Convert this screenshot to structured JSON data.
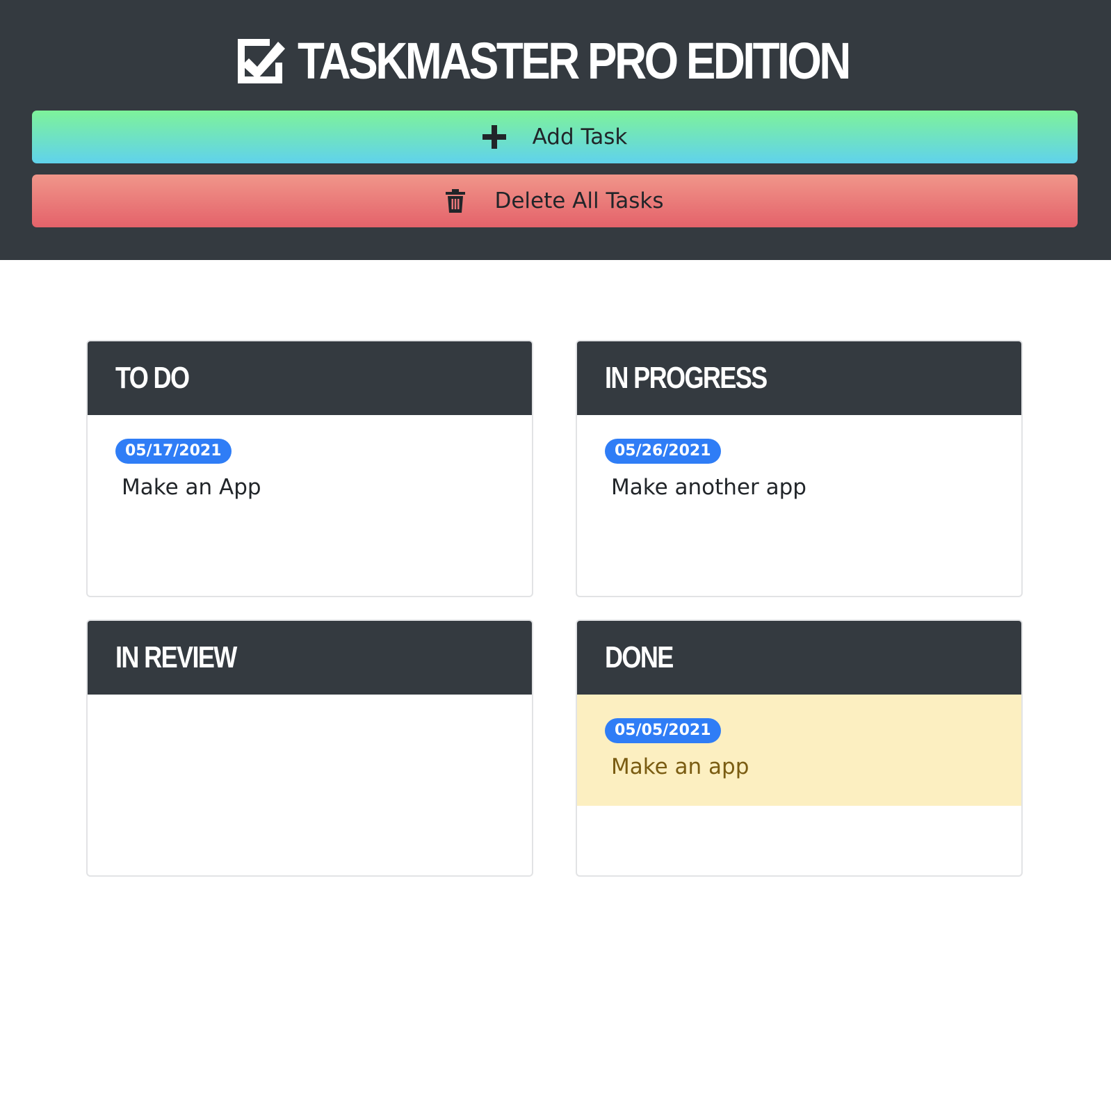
{
  "app": {
    "title": "TASKMASTER PRO EDITION",
    "title_icon": "checkbox-icon"
  },
  "toolbar": {
    "add_label": "Add Task",
    "add_icon": "plus-icon",
    "delete_label": "Delete All Tasks",
    "delete_icon": "trash-icon"
  },
  "colors": {
    "header_bg": "#343a40",
    "badge_bg": "#2f7df6",
    "done_highlight": "#fcefc1",
    "add_gradient": [
      "#7ef29a",
      "#60d2ec"
    ],
    "delete_gradient": [
      "#f0968a",
      "#e4626a"
    ]
  },
  "columns": [
    {
      "title": "TO DO",
      "tasks": [
        {
          "date": "05/17/2021",
          "text": "Make an App"
        }
      ]
    },
    {
      "title": "IN PROGRESS",
      "tasks": [
        {
          "date": "05/26/2021",
          "text": "Make another app"
        }
      ]
    },
    {
      "title": "IN REVIEW",
      "tasks": []
    },
    {
      "title": "DONE",
      "tasks": [
        {
          "date": "05/05/2021",
          "text": "Make an app"
        }
      ]
    }
  ]
}
